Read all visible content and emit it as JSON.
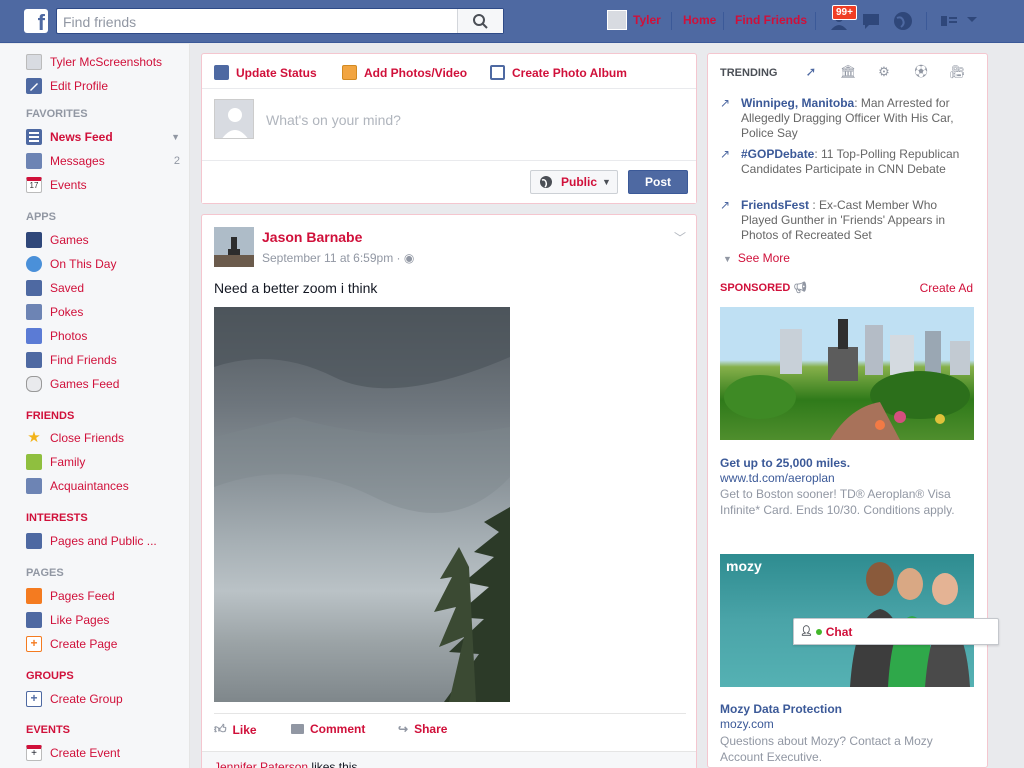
{
  "topbar": {
    "logo": "f",
    "search_placeholder": "Find friends",
    "user_name": "Tyler",
    "home": "Home",
    "find_friends": "Find Friends",
    "notifications_count": "99+"
  },
  "left_nav": {
    "profile_name": "Tyler McScreenshots",
    "edit_profile": "Edit Profile",
    "favorites_header": "FAVORITES",
    "news_feed": "News Feed",
    "messages": "Messages",
    "messages_count": "2",
    "events": "Events",
    "events_icon_day": "17",
    "apps_header": "APPS",
    "apps": [
      "Games",
      "On This Day",
      "Saved",
      "Pokes",
      "Photos",
      "Find Friends",
      "Games Feed"
    ],
    "friends_header": "FRIENDS",
    "friends": [
      "Close Friends",
      "Family",
      "Acquaintances"
    ],
    "interests_header": "INTERESTS",
    "interests": [
      "Pages and Public ..."
    ],
    "pages_header": "PAGES",
    "pages": [
      "Pages Feed",
      "Like Pages",
      "Create Page"
    ],
    "groups_header": "GROUPS",
    "groups": [
      "Create Group"
    ],
    "events_header": "EVENTS",
    "events_items": [
      "Create Event"
    ]
  },
  "composer": {
    "update_status": "Update Status",
    "add_photos": "Add Photos/Video",
    "create_album": "Create Photo Album",
    "placeholder": "What's on your mind?",
    "privacy": "Public",
    "post_button": "Post"
  },
  "post": {
    "author": "Jason Barnabe",
    "timestamp": "September 11 at 6:59pm · ",
    "text": "Need a better zoom i think",
    "like": "Like",
    "comment": "Comment",
    "share": "Share",
    "liker": "Jennifer Paterson",
    "likes_suffix": " likes this."
  },
  "right": {
    "trending_title": "TRENDING",
    "trending": [
      {
        "topic": "Winnipeg, Manitoba",
        "text": ": Man Arrested for Allegedly Dragging Officer With His Car, Police Say"
      },
      {
        "topic": "#GOPDebate",
        "text": ": 11 Top-Polling Republican Candidates Participate in CNN Debate"
      },
      {
        "topic": "FriendsFest",
        "text": " : Ex-Cast Member Who Played Gunther in 'Friends' Appears in Photos of Recreated Set"
      }
    ],
    "see_more": "See More",
    "sponsored": "SPONSORED",
    "create_ad": "Create Ad",
    "ad1": {
      "title": "Get up to 25,000 miles.",
      "url": "www.td.com/aeroplan",
      "desc": "Get to Boston sooner! TD® Aeroplan® Visa Infinite* Card. Ends 10/30. Conditions apply."
    },
    "ad2": {
      "brand": "mozy",
      "title": "Mozy Data Protection",
      "url": "mozy.com",
      "desc": "Questions about Mozy? Contact a Mozy Account Executive."
    }
  },
  "chat": {
    "label": "Chat"
  }
}
